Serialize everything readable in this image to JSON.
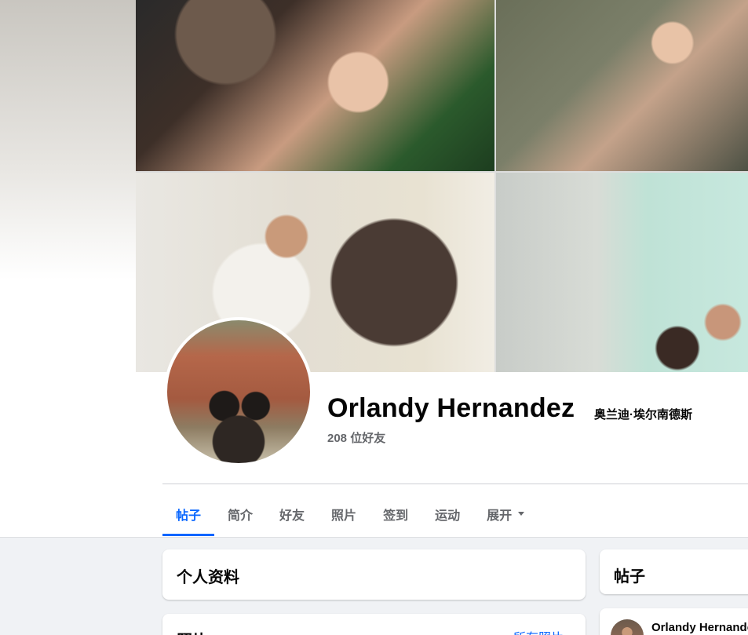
{
  "cover": {
    "photos": [
      "family-holiday-photo",
      "family-sitting-photo",
      "couple-on-couch-photo",
      "family-living-room-photo"
    ]
  },
  "profile": {
    "name": "Orlandy Hernandez",
    "alt_name": "奥兰迪·埃尔南德斯",
    "friends": "208 位好友"
  },
  "tabs": [
    {
      "label": "帖子",
      "active": true
    },
    {
      "label": "简介"
    },
    {
      "label": "好友"
    },
    {
      "label": "照片"
    },
    {
      "label": "签到"
    },
    {
      "label": "运动"
    },
    {
      "label": "展开"
    }
  ],
  "cards": {
    "intro_title": "个人资料",
    "photos_title": "照片",
    "photos_link": "所有照片",
    "posts_title": "帖子",
    "post_author": "Orlandy Hernandez"
  },
  "icons": {
    "more_tab": "caret-down-icon"
  },
  "colors": {
    "accent": "#0866ff",
    "muted_text": "#65676b",
    "page_bg": "#f0f2f5"
  }
}
